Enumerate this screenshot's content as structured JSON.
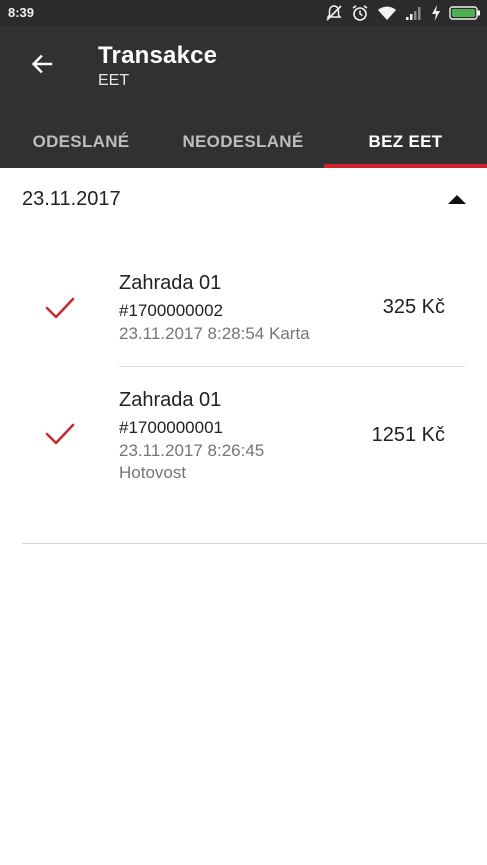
{
  "status_bar": {
    "time": "8:39",
    "icons": [
      "mute-icon",
      "alarm-icon",
      "wifi-icon",
      "signal-icon",
      "charging-icon",
      "battery-icon"
    ]
  },
  "app_bar": {
    "title": "Transakce",
    "subtitle": "EET",
    "back_icon": "arrow-left-icon"
  },
  "tabs": [
    {
      "label": "ODESLANÉ",
      "active": false
    },
    {
      "label": "NEODESLANÉ",
      "active": false
    },
    {
      "label": "BEZ EET",
      "active": true
    }
  ],
  "colors": {
    "app_bar": "#313131",
    "status_bar": "#2b2b2b",
    "accent": "#d51f2e"
  },
  "group": {
    "date": "23.11.2017",
    "expanded": true,
    "collapse_icon": "triangle-up-icon"
  },
  "transactions": [
    {
      "name": "Zahrada 01",
      "number": "#1700000002",
      "meta_line1": "23.11.2017 8:28:54 Karta",
      "meta_line2": "",
      "amount": "325 Kč",
      "status_icon": "check-icon"
    },
    {
      "name": "Zahrada 01",
      "number": "#1700000001",
      "meta_line1": "23.11.2017 8:26:45",
      "meta_line2": "Hotovost",
      "amount": "1251 Kč",
      "status_icon": "check-icon"
    }
  ]
}
